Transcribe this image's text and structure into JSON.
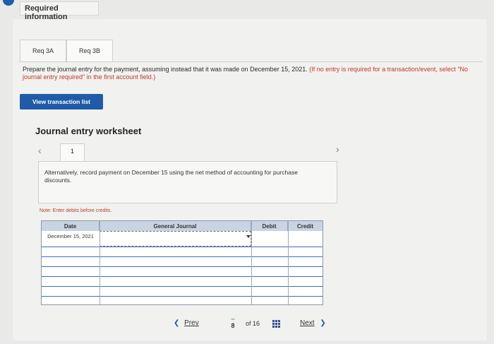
{
  "header": {
    "required_info": "Required information"
  },
  "tabs": [
    {
      "label": "Req 3A"
    },
    {
      "label": "Req 3B"
    }
  ],
  "instructions": {
    "main": "Prepare the journal entry for the payment, assuming instead that it was made on December 15, 2021.",
    "note": "(If no entry is required for a transaction/event, select \"No journal entry required\" in the first account field.)"
  },
  "buttons": {
    "view_transactions": "View transaction list"
  },
  "worksheet": {
    "title": "Journal entry worksheet",
    "current_tab": "1",
    "description": "Alternatively, record payment on December 15 using the net method of accounting for purchase discounts.",
    "note": "Note: Enter debits before credits."
  },
  "journal": {
    "headers": {
      "date": "Date",
      "account": "General Journal",
      "debit": "Debit",
      "credit": "Credit"
    },
    "rows": [
      {
        "date": "December 15, 2021",
        "account": "",
        "debit": "",
        "credit": ""
      },
      {
        "date": "",
        "account": "",
        "debit": "",
        "credit": ""
      },
      {
        "date": "",
        "account": "",
        "debit": "",
        "credit": ""
      },
      {
        "date": "",
        "account": "",
        "debit": "",
        "credit": ""
      },
      {
        "date": "",
        "account": "",
        "debit": "",
        "credit": ""
      },
      {
        "date": "",
        "account": "",
        "debit": "",
        "credit": ""
      }
    ]
  },
  "pagination": {
    "prev_label": "Prev",
    "current_page": "8",
    "total": "of 16",
    "next_label": "Next"
  },
  "colors": {
    "accent": "#1f5ba8",
    "note_red": "#c0392b",
    "header_bg": "#c8d4e2"
  }
}
